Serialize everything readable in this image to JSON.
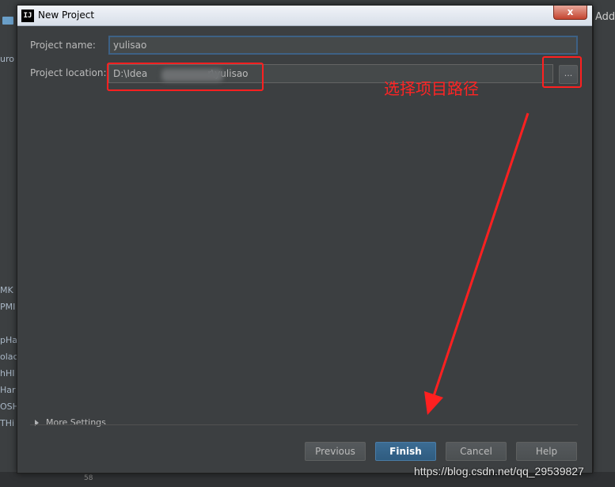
{
  "window": {
    "title": "New Project",
    "close_glyph": "x",
    "app_icon_text": "IJ"
  },
  "form": {
    "project_name_label": "Project name:",
    "project_name_value": "yulisao",
    "project_location_label": "Project location:",
    "project_location_prefix": "D:\\Idea",
    "project_location_suffix": "r\\yulisao",
    "browse_label": "..."
  },
  "more_settings": {
    "label": "More Settings"
  },
  "buttons": {
    "previous": "Previous",
    "finish": "Finish",
    "cancel": "Cancel",
    "help": "Help"
  },
  "annotation": {
    "text": "选择项目路径",
    "color": "#ff2020"
  },
  "background": {
    "left_fragments": [
      "MK",
      "PMI",
      "pHa",
      "olac",
      "hHI",
      "Har",
      "OSH",
      "THi"
    ],
    "top_left_fragment": "uro",
    "right_add": "Add",
    "line_number": "58"
  },
  "watermark": "https://blog.csdn.net/qq_29539827",
  "colors": {
    "dialog_bg": "#3c3f41",
    "focus_border": "#3d6185",
    "primary_button": "#365880"
  }
}
